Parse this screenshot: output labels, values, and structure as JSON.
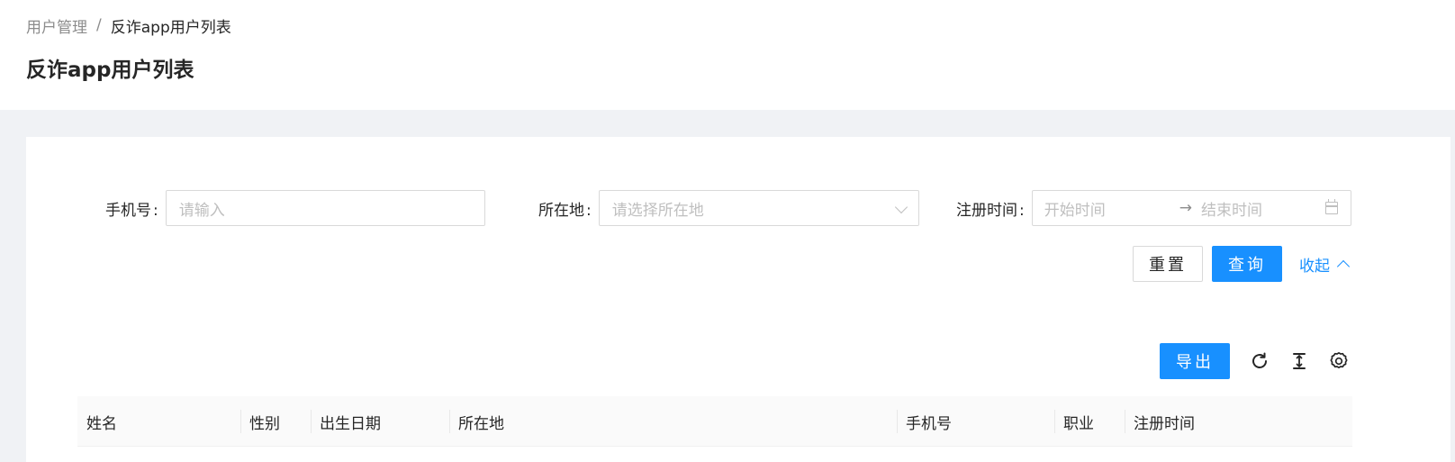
{
  "breadcrumb": {
    "parent": "用户管理",
    "separator": "/",
    "current": "反诈app用户列表"
  },
  "page_title": "反诈app用户列表",
  "search_form": {
    "phone": {
      "label": "手机号",
      "placeholder": "请输入"
    },
    "location": {
      "label": "所在地",
      "placeholder": "请选择所在地"
    },
    "register_time": {
      "label": "注册时间",
      "start_placeholder": "开始时间",
      "end_placeholder": "结束时间",
      "arrow": "→"
    },
    "colon": ":",
    "reset_label": "重置",
    "query_label": "查询",
    "collapse_label": "收起"
  },
  "toolbar": {
    "export_label": "导出",
    "icons": [
      "reload-icon",
      "density-icon",
      "settings-icon"
    ]
  },
  "table": {
    "columns": [
      "姓名",
      "性别",
      "出生日期",
      "所在地",
      "手机号",
      "职业",
      "注册时间"
    ]
  },
  "colors": {
    "primary": "#1890ff",
    "background": "#f0f2f5",
    "header_bg": "#fafafa"
  }
}
